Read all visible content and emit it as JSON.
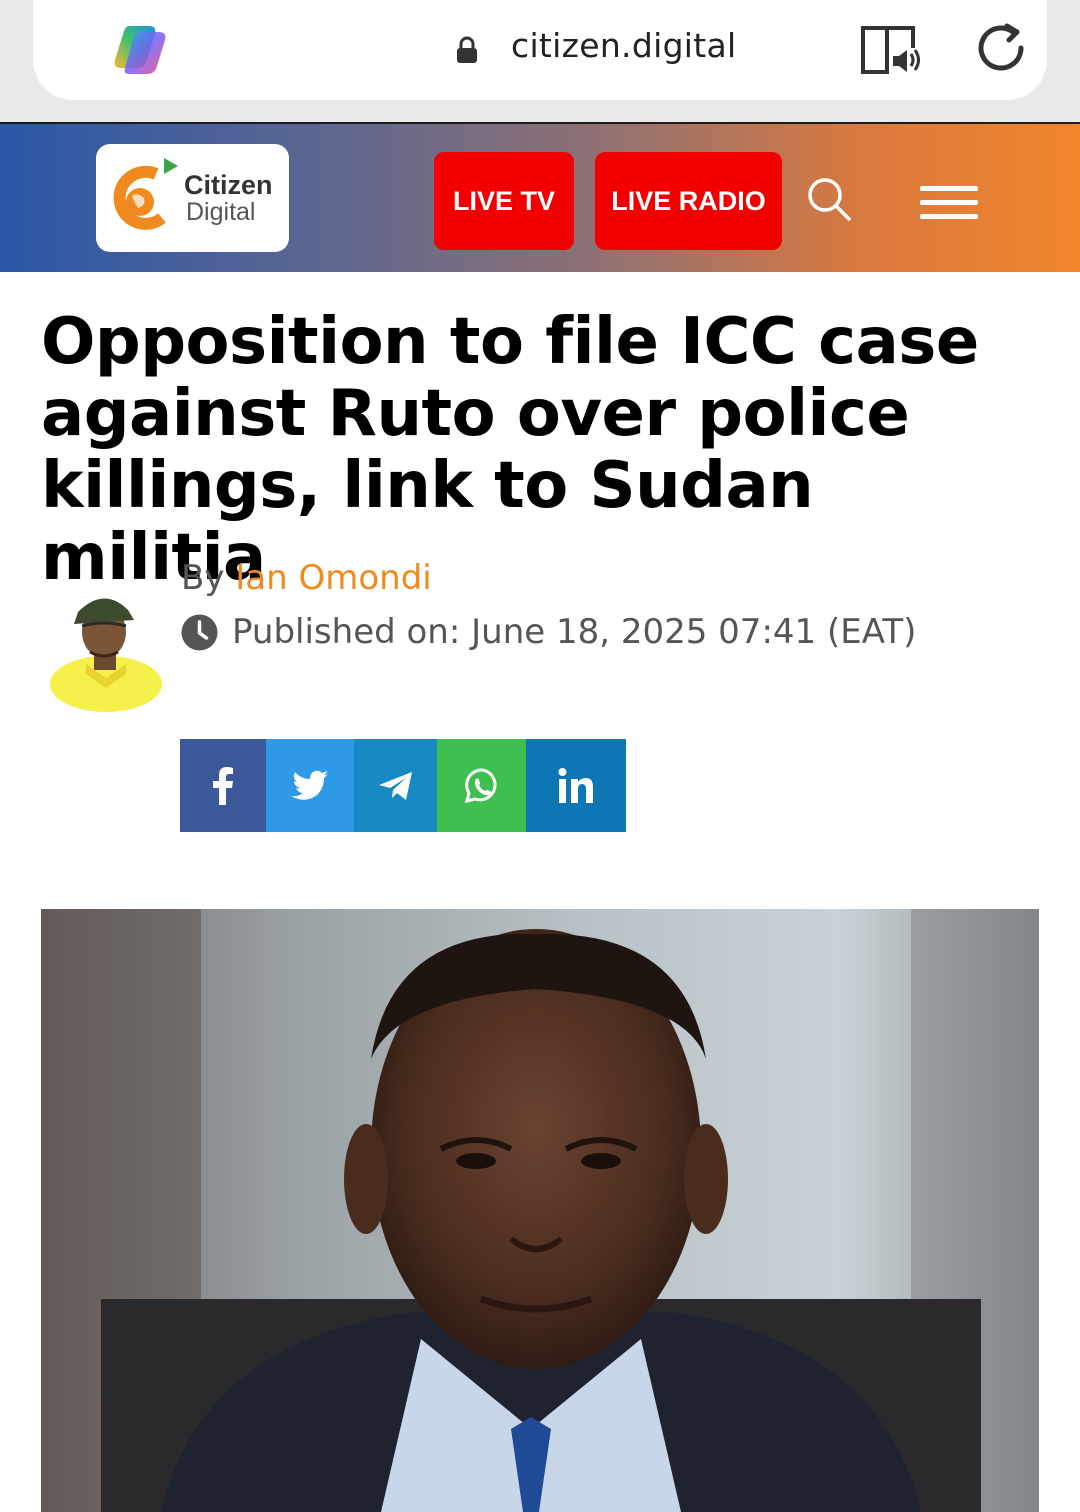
{
  "browser": {
    "url": "citizen.digital"
  },
  "site": {
    "logo_line1": "Citizen",
    "logo_line2": "Digital",
    "live_tv_label": "LIVE TV",
    "live_radio_label": "LIVE RADIO"
  },
  "article": {
    "headline": "Opposition to file ICC case against Ruto over police killings, link to Sudan militia",
    "by_prefix": "By",
    "author": "Ian Omondi",
    "published": "Published on: June 18, 2025 07:41 (EAT)"
  },
  "share": {
    "buttons": [
      "facebook-icon",
      "twitter-icon",
      "telegram-icon",
      "whatsapp-icon",
      "linkedin-icon"
    ]
  },
  "colors": {
    "live_button": "#f20000",
    "author_link": "#f08a1e",
    "facebook": "#3b5998",
    "twitter": "#2f9ae8",
    "telegram": "#178ac4",
    "whatsapp": "#3fbf4f",
    "linkedin": "#0e76b5"
  }
}
